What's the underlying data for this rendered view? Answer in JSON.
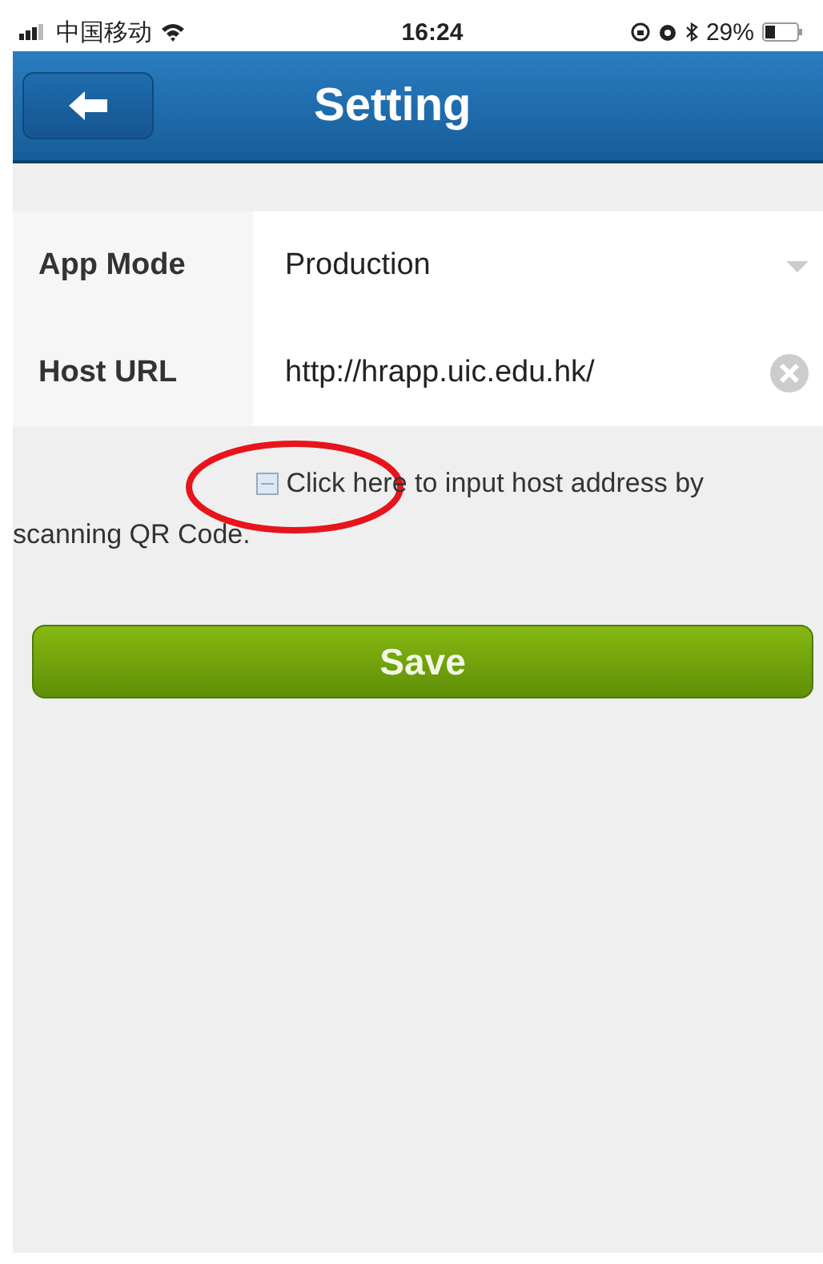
{
  "status_bar": {
    "carrier": "中国移动",
    "time": "16:24",
    "battery": "29%"
  },
  "header": {
    "title": "Setting"
  },
  "form": {
    "rows": [
      {
        "kind": "select",
        "label": "App Mode",
        "value": "Production"
      },
      {
        "kind": "text",
        "label": "Host URL",
        "value": "http://hrapp.uic.edu.hk/"
      }
    ]
  },
  "qr_hint": "Click here to input host address by scanning QR Code.",
  "save_button": "Save"
}
